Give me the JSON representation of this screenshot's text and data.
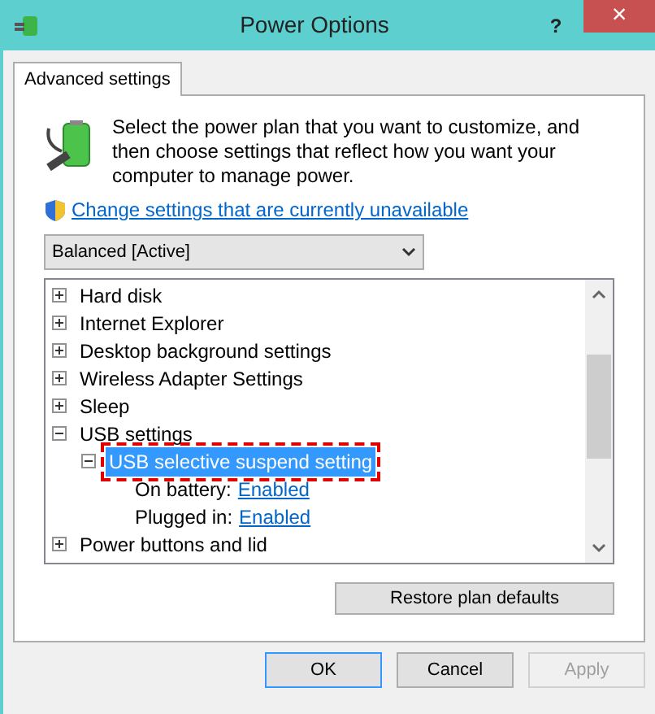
{
  "window": {
    "title": "Power Options",
    "help": "?",
    "close": "×"
  },
  "tabs": [
    {
      "label": "Advanced settings",
      "selected": true
    }
  ],
  "intro": "Select the power plan that you want to customize, and then choose settings that reflect how you want your computer to manage power.",
  "link": "Change settings that are currently unavailable",
  "plan_select": {
    "value": "Balanced [Active]"
  },
  "tree": [
    {
      "label": "Hard disk",
      "expanded": false,
      "selected": false
    },
    {
      "label": "Internet Explorer",
      "expanded": false,
      "selected": false
    },
    {
      "label": "Desktop background settings",
      "expanded": false,
      "selected": false
    },
    {
      "label": "Wireless Adapter Settings",
      "expanded": false,
      "selected": false
    },
    {
      "label": "Sleep",
      "expanded": false,
      "selected": false
    },
    {
      "label": "USB settings",
      "expanded": true,
      "selected": false,
      "children": [
        {
          "label": "USB selective suspend setting",
          "expanded": true,
          "selected": true,
          "highlighted": true,
          "children": [
            {
              "kind": "setting",
              "label": "On battery:",
              "value": "Enabled"
            },
            {
              "kind": "setting",
              "label": "Plugged in:",
              "value": "Enabled"
            }
          ]
        }
      ]
    },
    {
      "label": "Power buttons and lid",
      "expanded": false,
      "selected": false
    }
  ],
  "restore_button": "Restore plan defaults",
  "buttons": [
    {
      "label": "OK",
      "default": true,
      "disabled": false
    },
    {
      "label": "Cancel",
      "default": false,
      "disabled": false
    },
    {
      "label": "Apply",
      "default": false,
      "disabled": true
    }
  ]
}
